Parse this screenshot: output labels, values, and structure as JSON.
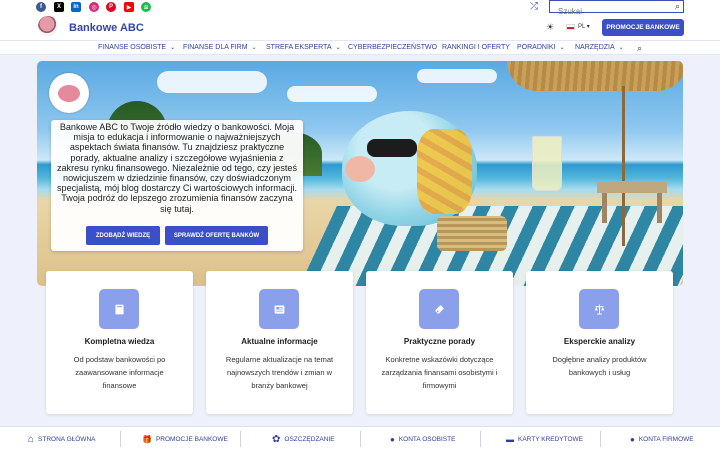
{
  "social": [
    {
      "name": "facebook",
      "glyph": "f",
      "color": "#3b5998"
    },
    {
      "name": "x",
      "glyph": "X",
      "color": "#000000"
    },
    {
      "name": "linkedin",
      "glyph": "in",
      "color": "#0a66c2"
    },
    {
      "name": "instagram",
      "glyph": "◎",
      "color": "#d62976"
    },
    {
      "name": "pinterest",
      "glyph": "P",
      "color": "#e60023"
    },
    {
      "name": "youtube",
      "glyph": "▶",
      "color": "#ff0000"
    },
    {
      "name": "spotify",
      "glyph": "≋",
      "color": "#1db954"
    }
  ],
  "search": {
    "placeholder": "Szukaj"
  },
  "header": {
    "brand": "Bankowe ABC",
    "lang": "PL ▾",
    "promo_button": "PROMOCJE BANKOWE"
  },
  "nav": {
    "items": [
      {
        "label": "FINANSE OSOBISTE",
        "chev": "⌄"
      },
      {
        "label": "FINANSE DLA FIRM",
        "chev": "⌄"
      },
      {
        "label": "STREFA EKSPERTA",
        "chev": "⌄"
      },
      {
        "label": "CYBERBEZPIECZEŃSTWO",
        "chev": ""
      },
      {
        "label": "RANKINGI I OFERTY",
        "chev": ""
      },
      {
        "label": "PORADNIKI",
        "chev": "⌄"
      },
      {
        "label": "NARZĘDZIA",
        "chev": "⌄"
      }
    ]
  },
  "hero": {
    "text": "Bankowe ABC to Twoje źródło wiedzy o bankowości. Moja misja to edukacja i informowanie o najważniejszych aspektach świata finansów. Tu znajdziesz praktyczne porady, aktualne analizy i szczegółowe wyjaśnienia z zakresu rynku finansowego. Niezależnie od tego, czy jesteś nowicjuszem w dziedzinie finansów, czy doświadczonym specjalistą, mój blog dostarczy Ci wartościowych informacji.",
    "text2": "Twoja podróż do lepszego zrozumienia finansów zaczyna się tutaj.",
    "button_primary": "ZDOBĄDŹ WIEDZĘ",
    "button_secondary": "SPRAWDŹ OFERTĘ BANKÓW"
  },
  "cards": [
    {
      "icon": "book-icon",
      "title": "Kompletna wiedza",
      "desc": "Od podstaw bankowości po zaawansowane informacje finansowe"
    },
    {
      "icon": "newspaper-icon",
      "title": "Aktualne informacje",
      "desc": "Regularne aktualizacje na temat najnowszych trendów i zmian w branży bankowej"
    },
    {
      "icon": "tag-icon",
      "title": "Praktyczne porady",
      "desc": "Konkretne wskazówki dotyczące zarządzania finansami osobistymi i firmowymi"
    },
    {
      "icon": "scale-icon",
      "title": "Eksperckie analizy",
      "desc": "Dogłębne analizy produktów bankowych i usług"
    }
  ],
  "bottom_nav": [
    {
      "icon": "home-icon",
      "glyph": "⌂",
      "label": "STRONA GŁÓWNA"
    },
    {
      "icon": "gift-icon",
      "glyph": "🎁",
      "label": "PROMOCJE BANKOWE"
    },
    {
      "icon": "piggy-bank-icon",
      "glyph": "✿",
      "label": "OSZCZĘDZANIE"
    },
    {
      "icon": "user-icon",
      "glyph": "●",
      "label": "KONTA OSOBISTE"
    },
    {
      "icon": "credit-card-icon",
      "glyph": "▬",
      "label": "KARTY KREDYTOWE"
    },
    {
      "icon": "business-user-icon",
      "glyph": "●",
      "label": "KONTA FIRMOWE"
    }
  ]
}
